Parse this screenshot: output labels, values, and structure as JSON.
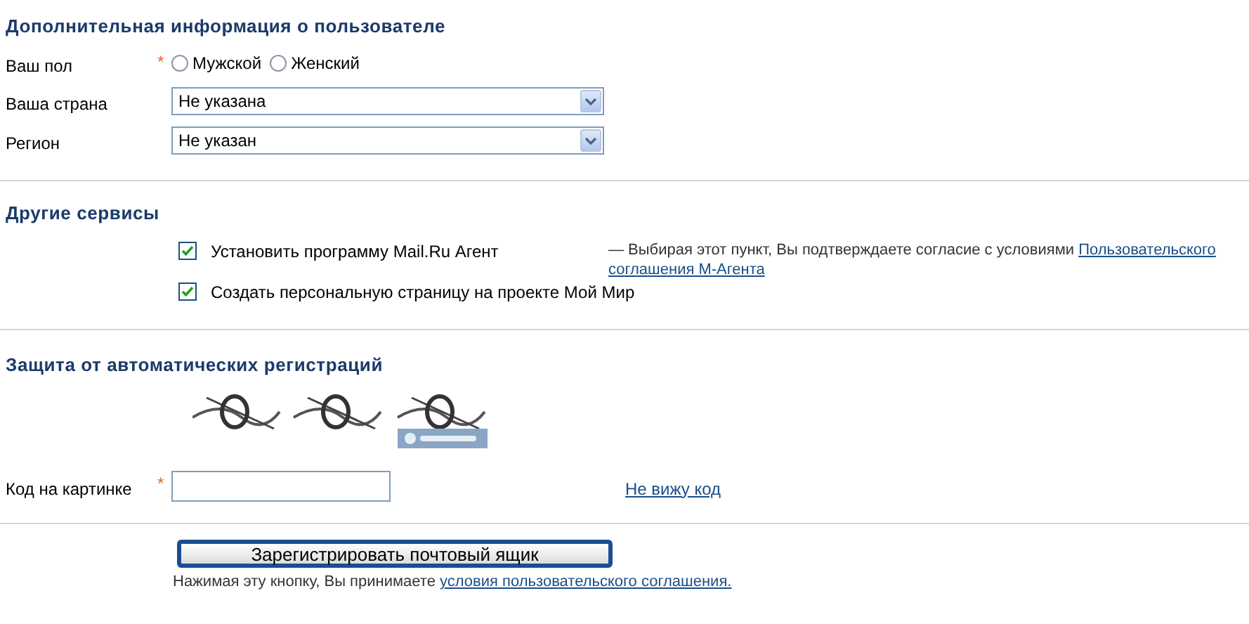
{
  "sections": [
    {
      "title": "Дополнительная информация о пользователе"
    },
    {
      "title": "Другие сервисы"
    },
    {
      "title": "Защита от автоматических регистраций"
    }
  ],
  "gender": {
    "label": "Ваш пол",
    "required_mark": "*",
    "options": [
      {
        "label": "Мужской",
        "selected": false
      },
      {
        "label": "Женский",
        "selected": false
      }
    ]
  },
  "selects": [
    {
      "label": "Ваша страна",
      "value": "Не указана"
    },
    {
      "label": "Регион",
      "value": "Не указан"
    }
  ],
  "services": [
    {
      "label": "Установить программу Mail.Ru Агент",
      "checked": true,
      "note": "— Выбирая этот пункт, Вы подтверждаете согласие с условиями ",
      "note_link": "Пользовательского соглашения М-Агента"
    },
    {
      "label": "Создать персональную страницу на проекте Мой Мир",
      "checked": true
    }
  ],
  "captcha": {
    "kind": "picture",
    "label": "Код на картинке",
    "required_mark": "*",
    "refresh_link": "Не вижу код"
  },
  "submit": {
    "label": "Зарегистрировать почтовый ящик",
    "note": "Нажимая эту кнопку, Вы принимаете ",
    "note_link": "условия пользовательского соглашения."
  }
}
